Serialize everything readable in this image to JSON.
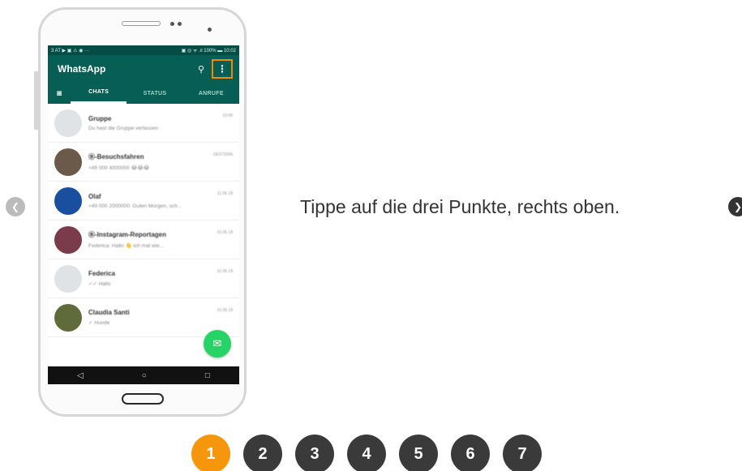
{
  "slide": {
    "instruction": "Tippe auf die drei Punkte, rechts oben."
  },
  "phone": {
    "statusbar": {
      "left": "3 AT ▶ ▣ ⚠ ◉ ···",
      "right": "▣ ◎ ᯤ .ıl 100% ▬ 10:02"
    },
    "app_title": "WhatsApp",
    "icons": {
      "search": "⚲",
      "menu": "⋮",
      "camera": "◙"
    },
    "tabs": [
      {
        "label": "CHATS"
      },
      {
        "label": "STATUS"
      },
      {
        "label": "ANRUFE"
      }
    ],
    "chats": [
      {
        "name": "Gruppe",
        "message": "Du hast die Gruppe verlassen",
        "time": "10:08",
        "color": "#dfe3e6"
      },
      {
        "name": "Ⓑ-Besuchsfahren",
        "message": "+49 000 4000000 😂😂😂",
        "time": "GESTERN",
        "color": "#6b5a4a"
      },
      {
        "name": "Olaf",
        "message": "+49 000 2000000: Guten Morgen, sch...",
        "time": "11.06.18",
        "color": "#1a4fa0"
      },
      {
        "name": "Ⓑ-Instagram-Reportagen",
        "message": "Federica: Hallo 👋 ich mal wie...",
        "time": "10.06.18",
        "color": "#7a3c4a"
      },
      {
        "name": "Federica",
        "message": "✓✓ Hallo",
        "time": "10.06.18",
        "color": "#dfe3e6"
      },
      {
        "name": "Claudia Santi",
        "message": "✓ Hunde",
        "time": "10.06.18",
        "color": "#5f6b3a"
      }
    ],
    "fab_icon": "✉",
    "nav": [
      "◁",
      "○",
      "□"
    ]
  },
  "nav_arrows": {
    "prev": "❮",
    "next": "❯"
  },
  "pagination": {
    "pages": [
      "1",
      "2",
      "3",
      "4",
      "5",
      "6",
      "7"
    ],
    "active": "1"
  },
  "colors": {
    "whatsapp_dark": "#075e54",
    "highlight": "#f08a00",
    "page_active": "#f5960c",
    "page_inactive": "#3a3a3a"
  }
}
